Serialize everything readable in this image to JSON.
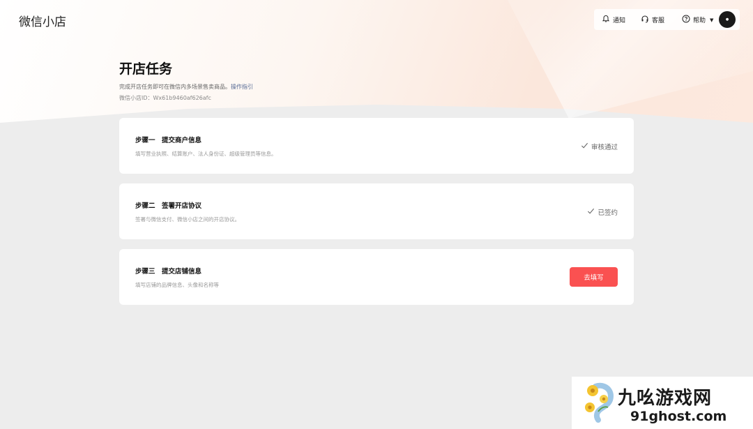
{
  "app": {
    "title": "微信小店"
  },
  "topbar": {
    "notify_label": "通知",
    "service_label": "客服",
    "help_label": "帮助",
    "avatar_icon": "user-avatar-icon"
  },
  "page": {
    "title": "开店任务",
    "description": "完成开店任务即可在微信内多场景售卖商品。",
    "guide_link": "操作指引",
    "shop_id": "微信小店ID：Wx61b9460af626afc"
  },
  "steps": [
    {
      "title": "步骤一　提交商户信息",
      "desc": "填写营业执照、结算账户、法人身份证、超级管理员等信息。",
      "status": "审核通过",
      "status_icon": "check-icon"
    },
    {
      "title": "步骤二　签署开店协议",
      "desc": "签署与微信支付、微信小店之间的开店协议。",
      "status": "已签约",
      "status_icon": "check-icon"
    },
    {
      "title": "步骤三　提交店铺信息",
      "desc": "填写店铺的品牌信息、头像和名称等",
      "action": "去填写"
    }
  ],
  "watermark": {
    "title": "九吆游戏网",
    "url": "91ghost.com"
  },
  "colors": {
    "accent": "#fa5151",
    "link": "#576b95",
    "background": "#ededed",
    "card": "#ffffff"
  }
}
